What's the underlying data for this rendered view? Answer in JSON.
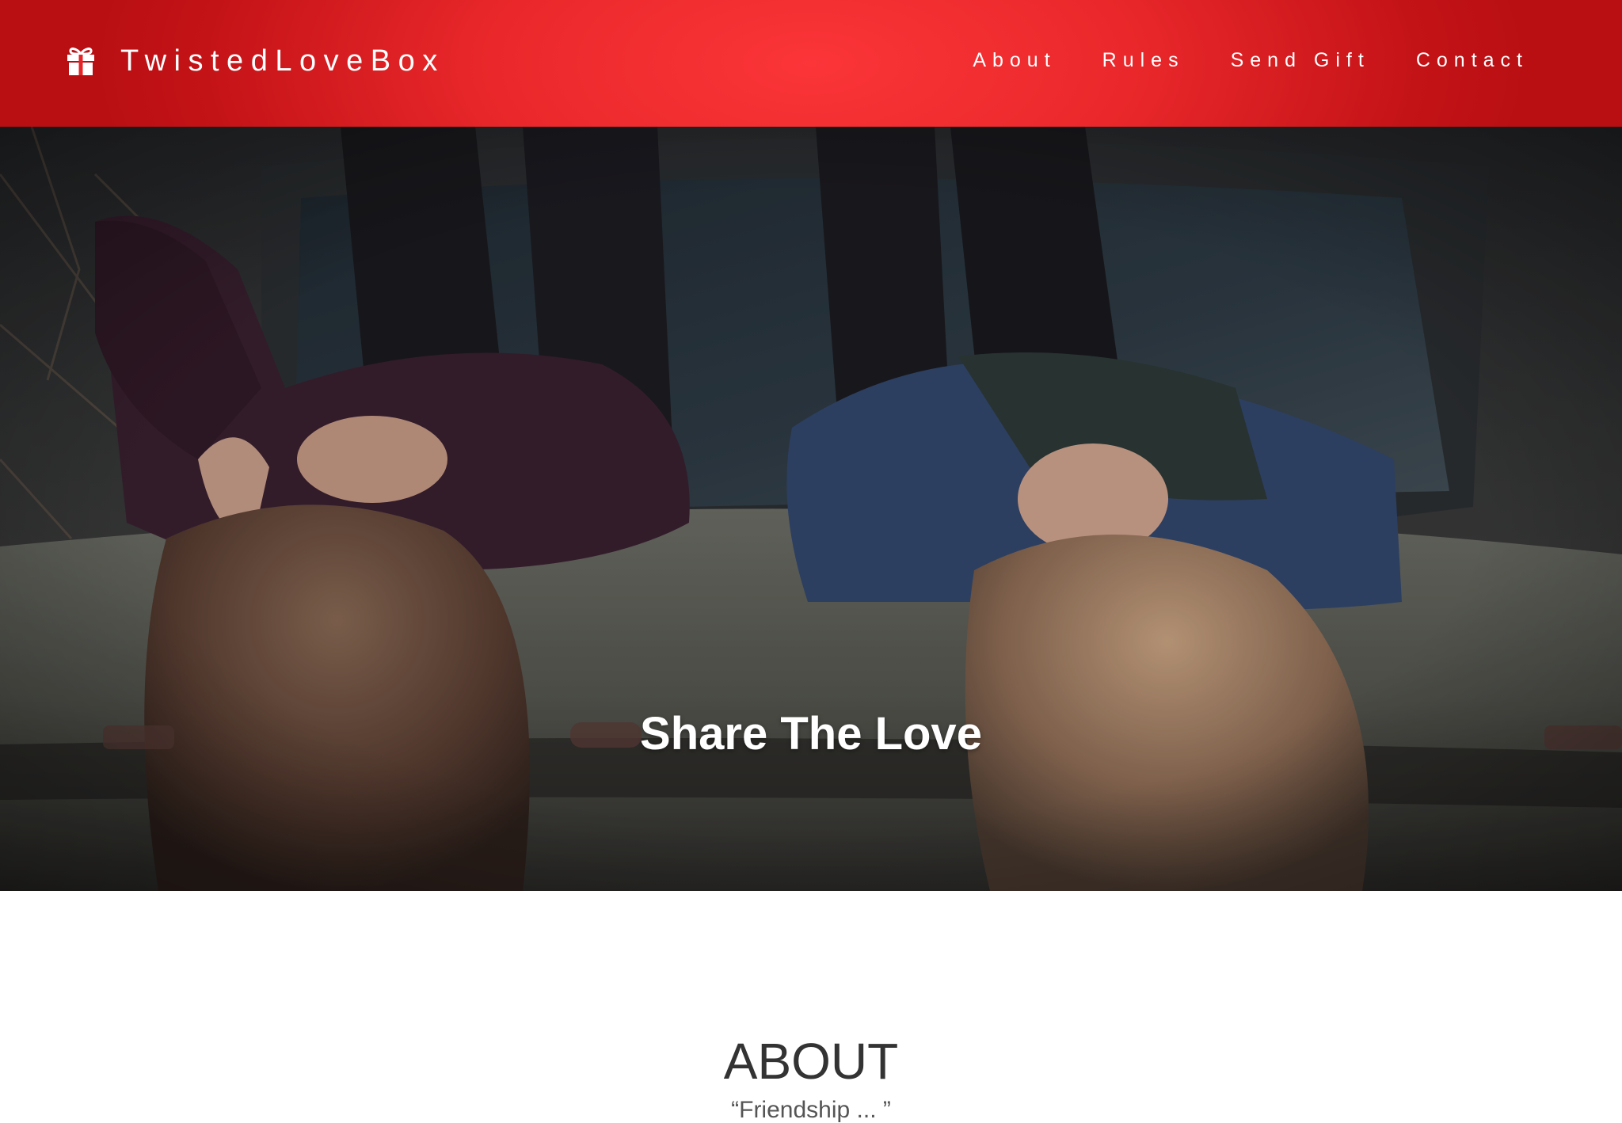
{
  "colors": {
    "navbar_accent": "#e8262a",
    "navbar_dark": "#b90f13",
    "text_light": "#ffffff",
    "heading": "#333333"
  },
  "navbar": {
    "brand": {
      "icon": "gift-icon",
      "label": "TwistedLoveBox"
    },
    "links": [
      {
        "label": "About"
      },
      {
        "label": "Rules"
      },
      {
        "label": "Send Gift"
      },
      {
        "label": "Contact"
      }
    ]
  },
  "hero": {
    "title": "Share The Love"
  },
  "about": {
    "heading": "ABOUT",
    "quote_partial": "“Friendship ... ”"
  }
}
